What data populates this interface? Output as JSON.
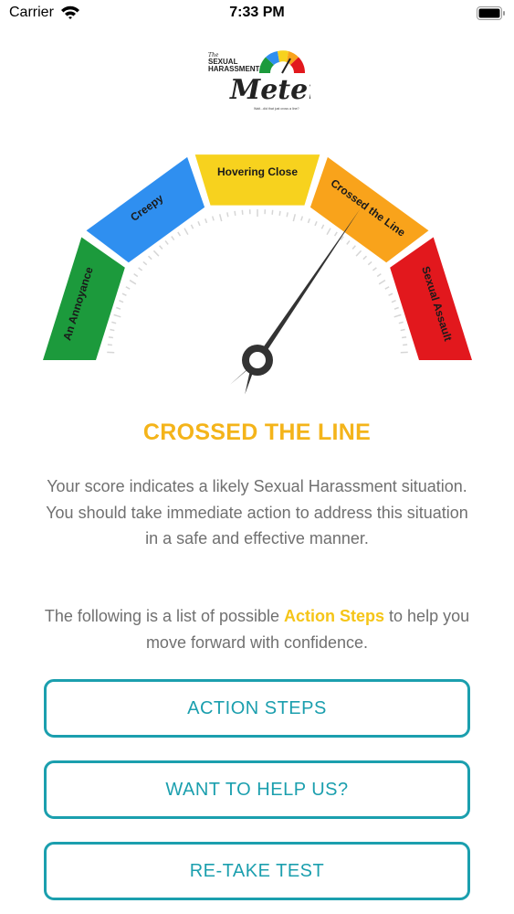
{
  "status_bar": {
    "carrier": "Carrier",
    "time": "7:33 PM",
    "icons": [
      "wifi-icon",
      "battery-icon"
    ]
  },
  "logo": {
    "line1": "The",
    "line2": "SEXUAL",
    "line3": "HARASSMENT",
    "line4": "Meter",
    "tagline": "Wait...did that just cross a line?"
  },
  "gauge": {
    "segments": [
      {
        "label": "An Annoyance",
        "color": "#1c9a3c"
      },
      {
        "label": "Creepy",
        "color": "#2f8ff0"
      },
      {
        "label": "Hovering Close",
        "color": "#f7d21e"
      },
      {
        "label": "Crossed the Line",
        "color": "#f9a31b"
      },
      {
        "label": "Sexual Assault",
        "color": "#e2181d"
      }
    ],
    "selected_index": 3,
    "needle_level": 0.69
  },
  "result": {
    "title": "CROSSED THE LINE",
    "title_color": "#f4b41a",
    "description": "Your score indicates a likely Sexual Harassment situation. You should take immediate action to address this situation in a safe and effective manner.",
    "actions_prefix": "The following is a list of possible ",
    "actions_link": "Action Steps",
    "actions_suffix": " to help you move forward with confidence."
  },
  "buttons": {
    "action_steps": "ACTION STEPS",
    "help_us": "WANT TO HELP US?",
    "retake": "RE-TAKE TEST"
  },
  "colors": {
    "accent": "#1b9fae",
    "highlight": "#f5c518"
  }
}
